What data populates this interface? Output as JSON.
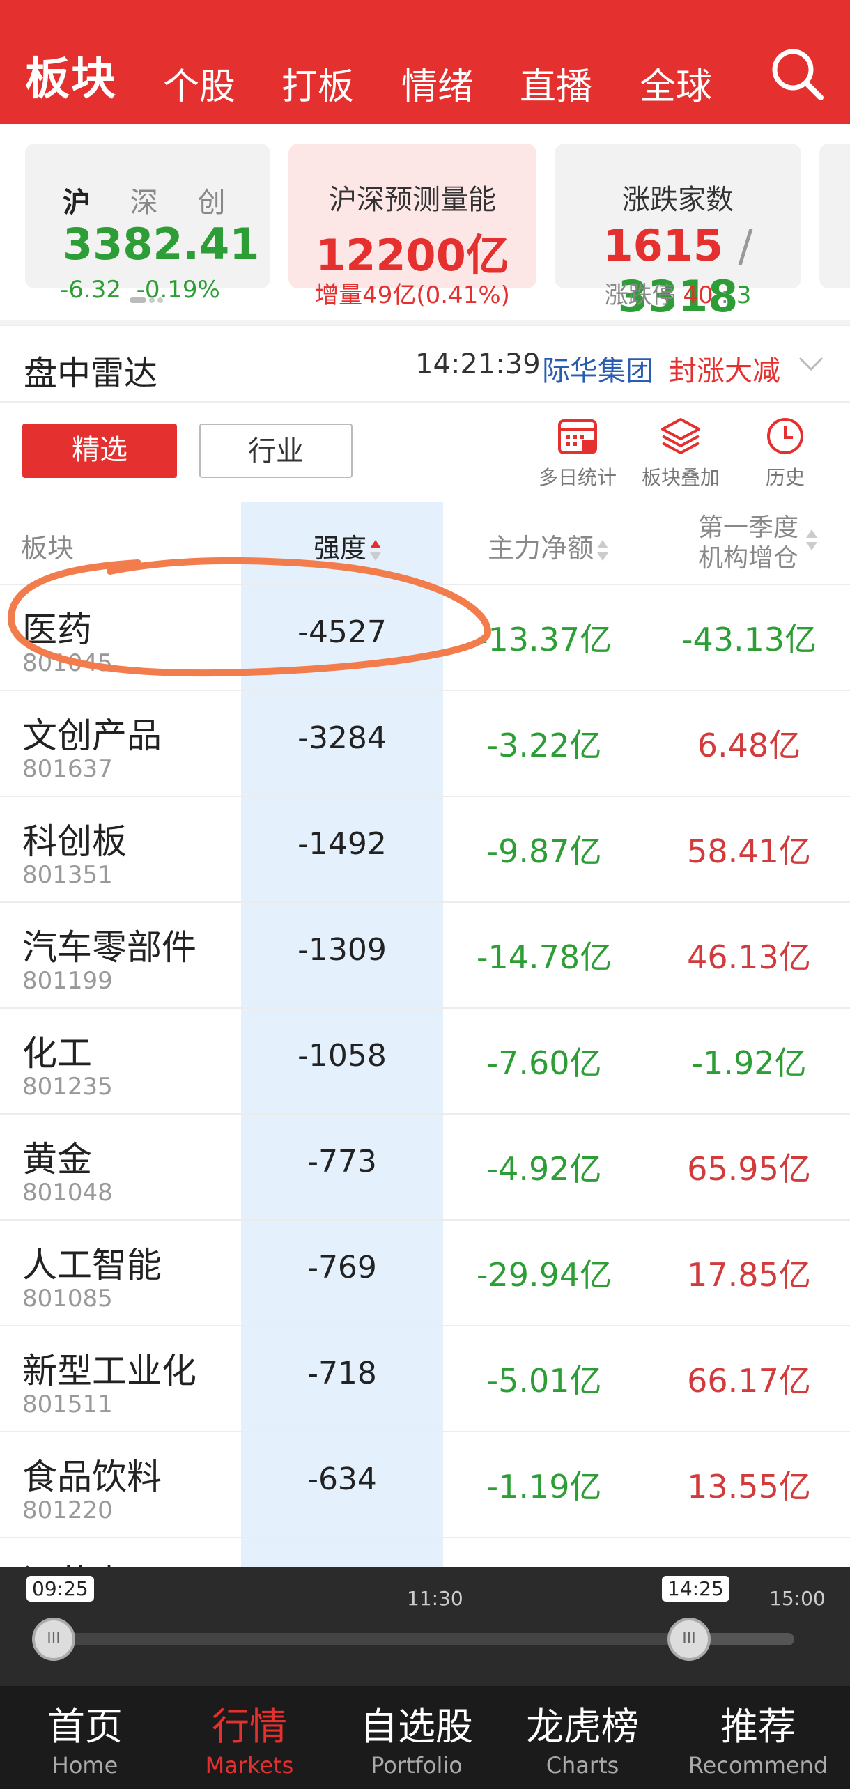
{
  "header": {
    "brand": "板块",
    "nav": [
      "个股",
      "打板",
      "情绪",
      "直播",
      "全球"
    ]
  },
  "index_card": {
    "tabs": [
      "沪",
      "深",
      "创"
    ],
    "value": "3382.41",
    "change": "-6.32  -0.19%"
  },
  "volume_card": {
    "title": "沪深预测量能",
    "value": "12200亿",
    "sub": "增量49亿(0.41%)"
  },
  "updown_card": {
    "title": "涨跌家数",
    "up": "1615",
    "sep": "/",
    "down": "3318",
    "limit_label": "涨跌停",
    "limit_up": "40",
    "limit_sep": ":",
    "limit_down": "3"
  },
  "radar": {
    "title": "盘中雷达",
    "time": "14:21:39",
    "stock": "际华集团",
    "event": "封涨大减"
  },
  "segments": {
    "selected": "精选",
    "industry": "行业"
  },
  "tools": [
    {
      "label": "多日统计",
      "icon": "calendar-stats-icon"
    },
    {
      "label": "板块叠加",
      "icon": "layers-icon"
    },
    {
      "label": "历史",
      "icon": "clock-icon"
    }
  ],
  "table": {
    "headers": {
      "sector": "板块",
      "strength": "强度",
      "net_flow": "主力净额",
      "inst_add_line1": "第一季度",
      "inst_add_line2": "机构增仓"
    },
    "rows": [
      {
        "name": "医药",
        "code": "801045",
        "strength": "-4527",
        "net_flow": "-13.37亿",
        "inst_add": "-43.13亿",
        "nf_sign": "neg",
        "ia_sign": "neg"
      },
      {
        "name": "文创产品",
        "code": "801637",
        "strength": "-3284",
        "net_flow": "-3.22亿",
        "inst_add": "6.48亿",
        "nf_sign": "neg",
        "ia_sign": "pos"
      },
      {
        "name": "科创板",
        "code": "801351",
        "strength": "-1492",
        "net_flow": "-9.87亿",
        "inst_add": "58.41亿",
        "nf_sign": "neg",
        "ia_sign": "pos"
      },
      {
        "name": "汽车零部件",
        "code": "801199",
        "strength": "-1309",
        "net_flow": "-14.78亿",
        "inst_add": "46.13亿",
        "nf_sign": "neg",
        "ia_sign": "pos"
      },
      {
        "name": "化工",
        "code": "801235",
        "strength": "-1058",
        "net_flow": "-7.60亿",
        "inst_add": "-1.92亿",
        "nf_sign": "neg",
        "ia_sign": "neg"
      },
      {
        "name": "黄金",
        "code": "801048",
        "strength": "-773",
        "net_flow": "-4.92亿",
        "inst_add": "65.95亿",
        "nf_sign": "neg",
        "ia_sign": "pos"
      },
      {
        "name": "人工智能",
        "code": "801085",
        "strength": "-769",
        "net_flow": "-29.94亿",
        "inst_add": "17.85亿",
        "nf_sign": "neg",
        "ia_sign": "pos"
      },
      {
        "name": "新型工业化",
        "code": "801511",
        "strength": "-718",
        "net_flow": "-5.01亿",
        "inst_add": "66.17亿",
        "nf_sign": "neg",
        "ia_sign": "pos"
      },
      {
        "name": "食品饮料",
        "code": "801220",
        "strength": "-634",
        "net_flow": "-1.19亿",
        "inst_add": "13.55亿",
        "nf_sign": "neg",
        "ia_sign": "pos"
      },
      {
        "name": "江苏省",
        "code": "",
        "strength": "",
        "net_flow": "",
        "inst_add": "",
        "nf_sign": "neg",
        "ia_sign": "pos"
      }
    ]
  },
  "timeline": {
    "start": "09:25",
    "mid": "11:30",
    "current": "14:25",
    "end": "15:00"
  },
  "bottom_nav": [
    {
      "zh": "首页",
      "en": "Home"
    },
    {
      "zh": "行情",
      "en": "Markets"
    },
    {
      "zh": "自选股",
      "en": "Portfolio"
    },
    {
      "zh": "龙虎榜",
      "en": "Charts"
    },
    {
      "zh": "推荐",
      "en": "Recommend"
    }
  ],
  "colors": {
    "brand_red": "#e4302e",
    "up_red": "#d23b3b",
    "down_green": "#2d9d35",
    "highlight_col": "#e4f0fc"
  }
}
